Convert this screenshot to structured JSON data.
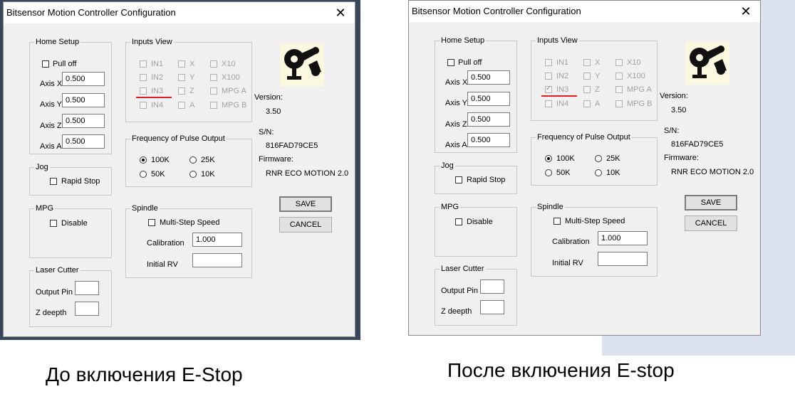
{
  "panels": [
    {
      "caption": "До включения E-Stop",
      "title": "Bitsensor Motion Controller Configuration",
      "close_glyph": "✕",
      "home_setup": {
        "label": "Home Setup",
        "pull_off": "Pull off",
        "axes": [
          {
            "label": "Axis X",
            "value": "0.500"
          },
          {
            "label": "Axis Y",
            "value": "0.500"
          },
          {
            "label": "Axis Z",
            "value": "0.500"
          },
          {
            "label": "Axis A",
            "value": "0.500"
          }
        ]
      },
      "inputs_view": {
        "label": "Inputs View",
        "col1": [
          "IN1",
          "IN2",
          "IN3",
          "IN4"
        ],
        "col2": [
          "X",
          "Y",
          "Z",
          "A"
        ],
        "col3": [
          "X10",
          "X100",
          "MPG A",
          "MPG B"
        ],
        "in3_checked": false
      },
      "jog": {
        "label": "Jog",
        "rapid_stop": "Rapid Stop"
      },
      "mpg": {
        "label": "MPG",
        "disable": "Disable"
      },
      "laser": {
        "label": "Laser Cutter",
        "output_pin": "Output Pin",
        "z_depth": "Z deepth",
        "output_pin_value": "",
        "z_depth_value": ""
      },
      "frequency": {
        "label": "Frequency of Pulse Output",
        "options": [
          "100K",
          "25K",
          "50K",
          "10K"
        ],
        "selected": "100K"
      },
      "spindle": {
        "label": "Spindle",
        "multi_step": "Multi-Step Speed",
        "calibration_label": "Calibration",
        "calibration_value": "1.000",
        "initial_rv_label": "Initial RV",
        "initial_rv_value": ""
      },
      "info": {
        "version_label": "Version:",
        "version": "3.50",
        "sn_label": "S/N:",
        "sn": "816FAD79CE5",
        "firmware_label": "Firmware:",
        "firmware": "RNR ECO MOTION 2.0"
      },
      "buttons": {
        "save": "SAVE",
        "cancel": "CANCEL"
      },
      "logo_icon": "robot-arm-logo-icon"
    },
    {
      "caption": "После включения E-stop",
      "title": "Bitsensor Motion Controller Configuration",
      "close_glyph": "✕",
      "home_setup": {
        "label": "Home Setup",
        "pull_off": "Pull off",
        "axes": [
          {
            "label": "Axis X",
            "value": "0.500"
          },
          {
            "label": "Axis Y",
            "value": "0.500"
          },
          {
            "label": "Axis Z",
            "value": "0.500"
          },
          {
            "label": "Axis A",
            "value": "0.500"
          }
        ]
      },
      "inputs_view": {
        "label": "Inputs View",
        "col1": [
          "IN1",
          "IN2",
          "IN3",
          "IN4"
        ],
        "col2": [
          "X",
          "Y",
          "Z",
          "A"
        ],
        "col3": [
          "X10",
          "X100",
          "MPG A",
          "MPG B"
        ],
        "in3_checked": true
      },
      "jog": {
        "label": "Jog",
        "rapid_stop": "Rapid Stop"
      },
      "mpg": {
        "label": "MPG",
        "disable": "Disable"
      },
      "laser": {
        "label": "Laser Cutter",
        "output_pin": "Output Pin",
        "z_depth": "Z deepth",
        "output_pin_value": "",
        "z_depth_value": ""
      },
      "frequency": {
        "label": "Frequency of Pulse Output",
        "options": [
          "100K",
          "25K",
          "50K",
          "10K"
        ],
        "selected": "100K"
      },
      "spindle": {
        "label": "Spindle",
        "multi_step": "Multi-Step Speed",
        "calibration_label": "Calibration",
        "calibration_value": "1.000",
        "initial_rv_label": "Initial RV",
        "initial_rv_value": ""
      },
      "info": {
        "version_label": "Version:",
        "version": "3.50",
        "sn_label": "S/N:",
        "sn": "816FAD79CE5",
        "firmware_label": "Firmware:",
        "firmware": "RNR ECO MOTION 2.0"
      },
      "buttons": {
        "save": "SAVE",
        "cancel": "CANCEL"
      },
      "logo_icon": "robot-arm-logo-icon"
    }
  ],
  "colors": {
    "dialog_bg": "#f0f0f0",
    "annotation_line": "#e02020",
    "desktop_bg": "#2b3a4a",
    "desktop_bg_right": "#dde3ee"
  }
}
